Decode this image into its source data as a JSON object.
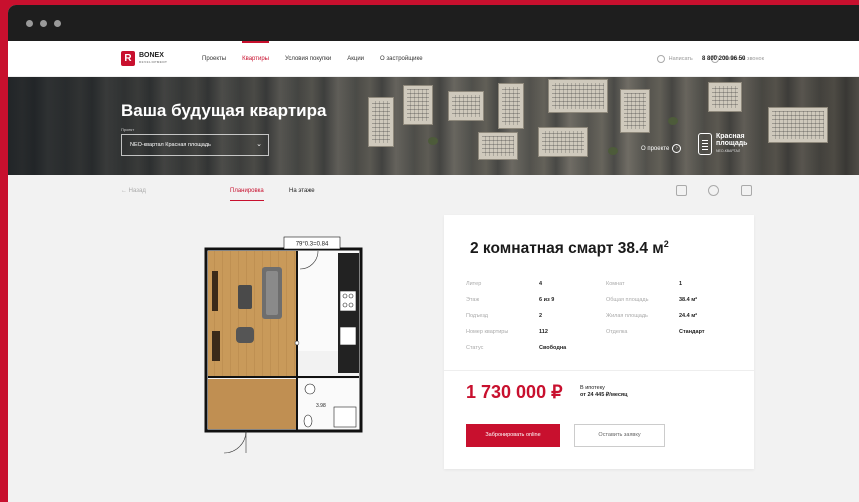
{
  "header": {
    "logo": {
      "name": "BONEX",
      "subtitle": "DEVELOPMENT"
    },
    "nav": [
      "Проекты",
      "Квартиры",
      "Условия покупки",
      "Акции",
      "О застройщике"
    ],
    "active_nav": "Квартиры",
    "links": [
      "Написать",
      "Заказать звонок"
    ],
    "phone": "8 800 200 96 50"
  },
  "hero": {
    "title": "Ваша будущая квартира",
    "select_label": "Проект",
    "select_value": "NEO-квартал Красная площадь",
    "about_link": "О проекте",
    "project_brand": {
      "line1": "Красная",
      "line2": "площадь",
      "subtitle": "NEO-КВАРТАЛ"
    }
  },
  "subbar": {
    "back": "← Назад",
    "tabs": [
      "Планировка",
      "На этаже"
    ],
    "active_tab": "Планировка",
    "tools": [
      "pdf-icon",
      "print-icon",
      "share-icon"
    ]
  },
  "plan": {
    "dimension_label": "79°0.3=0.84",
    "area_label": "3.98"
  },
  "card": {
    "title": "2 комнатная смарт 38.4 м",
    "title_sup": "2",
    "specs_left": [
      {
        "key": "Литер",
        "value": "4"
      },
      {
        "key": "Этаж",
        "value": "6 из 9"
      },
      {
        "key": "Подъезд",
        "value": "2"
      },
      {
        "key": "Номер квартиры",
        "value": "112"
      },
      {
        "key": "Статус",
        "value": "Свободна"
      }
    ],
    "specs_right": [
      {
        "key": "Комнат",
        "value": "1"
      },
      {
        "key": "Общая площадь",
        "value": "38.4 м²"
      },
      {
        "key": "Жилая площадь",
        "value": "24.4 м²"
      },
      {
        "key": "Отделка",
        "value": "Стандарт"
      }
    ],
    "price": "1 730 000 ₽",
    "mortgage_line1": "В ипотеку",
    "mortgage_line2": "от 24 445 ₽/месяц",
    "book_button": "Забронировать online",
    "request_button": "Оставить заявку"
  },
  "colors": {
    "accent": "#c8102e",
    "frame": "#1e1e1e",
    "background": "#f2f2f2"
  }
}
